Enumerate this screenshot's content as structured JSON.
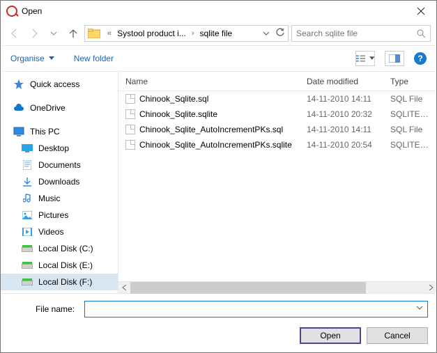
{
  "title": "Open",
  "breadcrumb": {
    "segment1": "Systool product i...",
    "segment2": "sqlite file"
  },
  "search_placeholder": "Search sqlite file",
  "toolbar": {
    "organise": "Organise",
    "newfolder": "New folder"
  },
  "columns": {
    "name": "Name",
    "date": "Date modified",
    "type": "Type"
  },
  "sidebar": {
    "quick": "Quick access",
    "onedrive": "OneDrive",
    "thispc": "This PC",
    "desktop": "Desktop",
    "documents": "Documents",
    "downloads": "Downloads",
    "music": "Music",
    "pictures": "Pictures",
    "videos": "Videos",
    "diskc": "Local Disk (C:)",
    "diske": "Local Disk (E:)",
    "diskf": "Local Disk (F:)"
  },
  "files": [
    {
      "name": "Chinook_Sqlite.sql",
      "date": "14-11-2010 14:11",
      "type": "SQL File"
    },
    {
      "name": "Chinook_Sqlite.sqlite",
      "date": "14-11-2010 20:32",
      "type": "SQLITE File"
    },
    {
      "name": "Chinook_Sqlite_AutoIncrementPKs.sql",
      "date": "14-11-2010 14:11",
      "type": "SQL File"
    },
    {
      "name": "Chinook_Sqlite_AutoIncrementPKs.sqlite",
      "date": "14-11-2010 20:54",
      "type": "SQLITE File"
    }
  ],
  "filename_label": "File name:",
  "buttons": {
    "open": "Open",
    "cancel": "Cancel"
  },
  "help": "?"
}
